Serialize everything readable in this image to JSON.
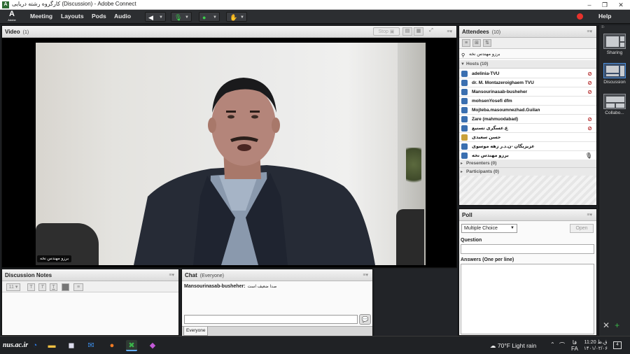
{
  "window": {
    "title": "کارگروه رشته دریایی (Discussion) - Adobe Connect",
    "app_icon": "adobe-connect-icon",
    "controls": [
      "–",
      "❐",
      "✕"
    ]
  },
  "menubar": {
    "logo_text": "Adobe",
    "items": [
      "Meeting",
      "Layouts",
      "Pods",
      "Audio"
    ],
    "help": "Help",
    "record_color": "#e8322c"
  },
  "video_pod": {
    "title": "Video",
    "count": "(1)",
    "stop_label": "Stop",
    "camera_label": "برزو مهندس نخه"
  },
  "attendees": {
    "title": "Attendees",
    "count": "(10)",
    "my_status": "برزو مهندس نخه",
    "hosts_label": "Hosts (10)",
    "hosts": [
      {
        "name": "adelinia-TVU",
        "flag": "mic-off"
      },
      {
        "name": "dr. M. Montazeroighaem TVU",
        "flag": "mic-off"
      },
      {
        "name": "Mansourinasab-busheher",
        "flag": "mic-off"
      },
      {
        "name": "mohsenYosefi dfm",
        "flag": ""
      },
      {
        "name": "Mojteba.masoumnezhad.Guilan",
        "flag": ""
      },
      {
        "name": "Zare (mahmuodabad)",
        "flag": "mic-off"
      },
      {
        "name": "ع.عسگری تسنیع",
        "flag": "mic-off"
      },
      {
        "name": "حسن سعیدی",
        "flag": ""
      },
      {
        "name": "عزیزیگان -ن.د.ر زهه موسوی ",
        "flag": ""
      },
      {
        "name": "برزو مهندس نخه",
        "flag": "mic-on"
      }
    ],
    "presenters_label": "Presenters (0)",
    "participants_label": "Participants (0)"
  },
  "poll": {
    "title": "Poll",
    "type_select": "Multiple Choice",
    "open_button": "Open",
    "question_label": "Question",
    "answers_label": "Answers (One per line)"
  },
  "layouts_rail": {
    "items": [
      "Sharing",
      "Discussion",
      "Collabo..."
    ],
    "active": "Discussion"
  },
  "notes_pod": {
    "title": "Discussion Notes"
  },
  "chat_pod": {
    "title": "Chat",
    "audience": "(Everyone)",
    "messages": [
      {
        "sender": "Mansourinasab-busheher:",
        "text": "صدا ضعیف است"
      }
    ],
    "tab": "Everyone"
  },
  "taskbar": {
    "brand": "nus.ac.ir",
    "weather": "70°F  Light rain",
    "tray_lang": "FA",
    "tray_lang_top": "فا",
    "time": "11:20 ق.ظ",
    "date": "۱۴۰۱/۰۲/۰۶",
    "notifications": "4"
  }
}
